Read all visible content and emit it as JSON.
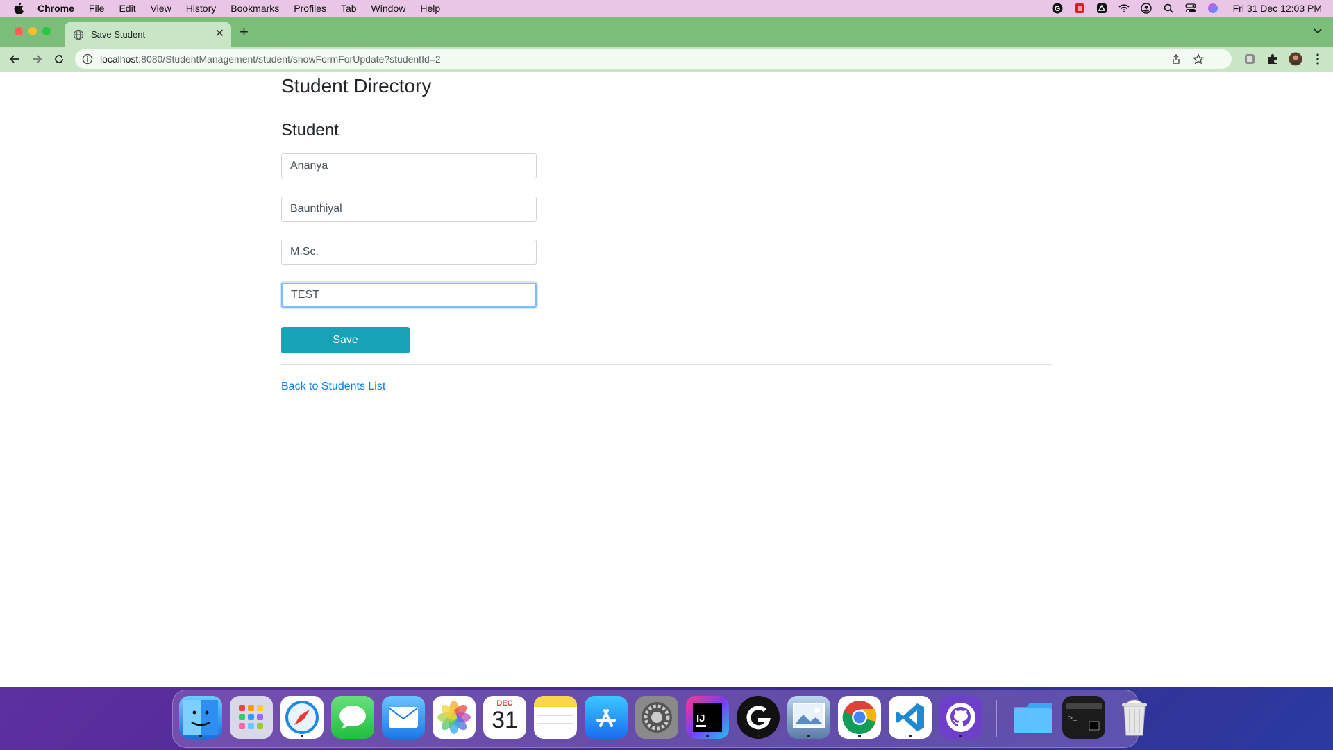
{
  "menubar": {
    "app_name": "Chrome",
    "items": [
      "File",
      "Edit",
      "View",
      "History",
      "Bookmarks",
      "Profiles",
      "Tab",
      "Window",
      "Help"
    ],
    "clock": "Fri 31 Dec  12:03 PM"
  },
  "browser": {
    "tab_title": "Save Student",
    "url_host": "localhost",
    "url_path": ":8080/StudentManagement/student/showFormForUpdate?studentId=2"
  },
  "page": {
    "title": "Student Directory",
    "section_title": "Student",
    "fields": {
      "first_name": "Ananya",
      "last_name": "Baunthiyal",
      "course": "M.Sc.",
      "extra": "TEST"
    },
    "save_label": "Save",
    "back_link": "Back to Students List"
  },
  "dock": {
    "apps": [
      "Finder",
      "Launchpad",
      "Safari",
      "Messages",
      "Mail",
      "Photos",
      "Calendar",
      "Notes",
      "App Store",
      "System Preferences",
      "IntelliJ IDEA",
      "Logitech G HUB",
      "Preview",
      "Google Chrome",
      "Visual Studio Code",
      "GitHub Desktop",
      "Downloads",
      "Terminal",
      "Trash"
    ],
    "calendar_month": "DEC",
    "calendar_day": "31"
  },
  "colors": {
    "tabbar": "#7dbd7a",
    "toolbar": "#c8e6c6",
    "save_button": "#17a2b8",
    "link": "#007bff"
  }
}
